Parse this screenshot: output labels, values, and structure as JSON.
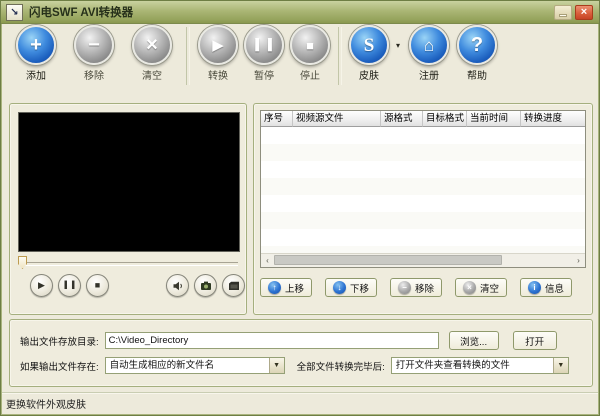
{
  "window": {
    "title": "闪电SWF AVI转换器",
    "app_icon_glyph": "↘",
    "close_glyph": "×",
    "status_text": "更换软件外观皮肤"
  },
  "toolbar": {
    "buttons": [
      {
        "label": "添加",
        "glyph": "+",
        "state": "enabled"
      },
      {
        "label": "移除",
        "glyph": "−",
        "state": "disabled"
      },
      {
        "label": "清空",
        "glyph": "×",
        "state": "disabled"
      },
      {
        "label": "转换",
        "glyph": "▶",
        "state": "disabled"
      },
      {
        "label": "暂停",
        "glyph": "▌▐",
        "state": "disabled"
      },
      {
        "label": "停止",
        "glyph": "■",
        "state": "disabled"
      },
      {
        "label": "皮肤",
        "glyph": "S",
        "state": "enabled"
      },
      {
        "label": "注册",
        "glyph": "⌂",
        "state": "enabled"
      },
      {
        "label": "帮助",
        "glyph": "?",
        "state": "enabled"
      }
    ],
    "skin_dropdown_glyph": "▾"
  },
  "player": {
    "play_glyph": "▶",
    "pause_glyph": "▌▐",
    "stop_glyph": "■"
  },
  "table": {
    "columns": [
      "序号",
      "视频源文件",
      "源格式",
      "目标格式",
      "当前时间",
      "转换进度"
    ],
    "rows": []
  },
  "scrollbar": {
    "left_glyph": "‹",
    "right_glyph": "›"
  },
  "list_actions": [
    {
      "label": "上移",
      "glyph": "↑",
      "color": "blue"
    },
    {
      "label": "下移",
      "glyph": "↓",
      "color": "blue"
    },
    {
      "label": "移除",
      "glyph": "−",
      "color": "gray"
    },
    {
      "label": "清空",
      "glyph": "×",
      "color": "gray"
    },
    {
      "label": "信息",
      "glyph": "i",
      "color": "blue"
    }
  ],
  "output": {
    "dir_label": "输出文件存放目录:",
    "dir_value": "C:\\Video_Directory",
    "browse_label": "浏览...",
    "open_label": "打开",
    "exists_label": "如果输出文件存在:",
    "exists_value": "自动生成相应的新文件名",
    "done_label": "全部文件转换完毕后:",
    "done_value": "打开文件夹查看转换的文件",
    "combo_arrow_glyph": "▼"
  },
  "colors": {
    "titlebar_olive": "#AAB675",
    "accent_blue": "#1C5FBE",
    "close_red": "#C74425",
    "window_bg": "#EDEADB"
  }
}
